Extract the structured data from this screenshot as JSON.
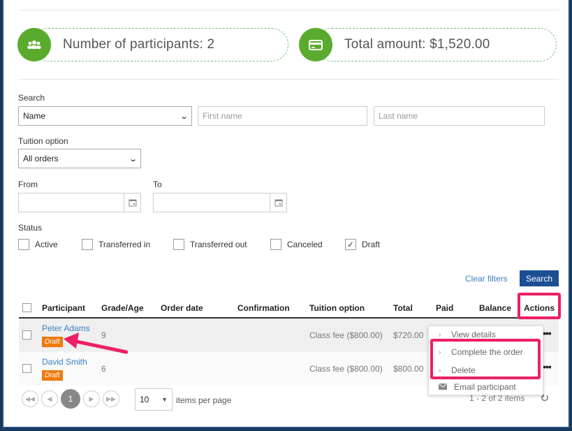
{
  "stats": {
    "participants_label": "Number of participants: 2",
    "total_label": "Total amount: $1,520.00"
  },
  "filters": {
    "search_label": "Search",
    "search_by_value": "Name",
    "first_name_placeholder": "First name",
    "last_name_placeholder": "Last name",
    "tuition_label": "Tuition option",
    "tuition_value": "All orders",
    "from_label": "From",
    "to_label": "To",
    "status_label": "Status",
    "statuses": [
      {
        "label": "Active",
        "checked": false
      },
      {
        "label": "Transferred in",
        "checked": false
      },
      {
        "label": "Transferred out",
        "checked": false
      },
      {
        "label": "Canceled",
        "checked": false
      },
      {
        "label": "Draft",
        "checked": true
      }
    ],
    "clear_label": "Clear filters",
    "search_button": "Search"
  },
  "table": {
    "headers": {
      "participant": "Participant",
      "grade": "Grade/Age",
      "order_date": "Order date",
      "confirmation": "Confirmation",
      "tuition": "Tuition option",
      "total": "Total",
      "paid": "Paid",
      "balance": "Balance",
      "actions": "Actions"
    },
    "rows": [
      {
        "name": "Peter Adams",
        "badge": "Draft",
        "grade": "9",
        "tuition": "Class fee ($800.00)",
        "total": "$720.00"
      },
      {
        "name": "David Smith",
        "badge": "Draft",
        "grade": "6",
        "tuition": "Class fee ($800.00)",
        "total": "$800.00"
      }
    ]
  },
  "actions_menu": {
    "items": [
      "View details",
      "Complete the order",
      "Delete",
      "Email participant"
    ]
  },
  "pager": {
    "current_page": "1",
    "page_size": "10",
    "per_page_label": "items per page",
    "summary": "1 - 2 of 2 items"
  },
  "colors": {
    "accent_green": "#5aab2d",
    "primary_blue": "#1c4e94",
    "link_blue": "#3a7fc1",
    "draft_orange": "#f07a0c",
    "highlight_pink": "#ee1f63"
  }
}
